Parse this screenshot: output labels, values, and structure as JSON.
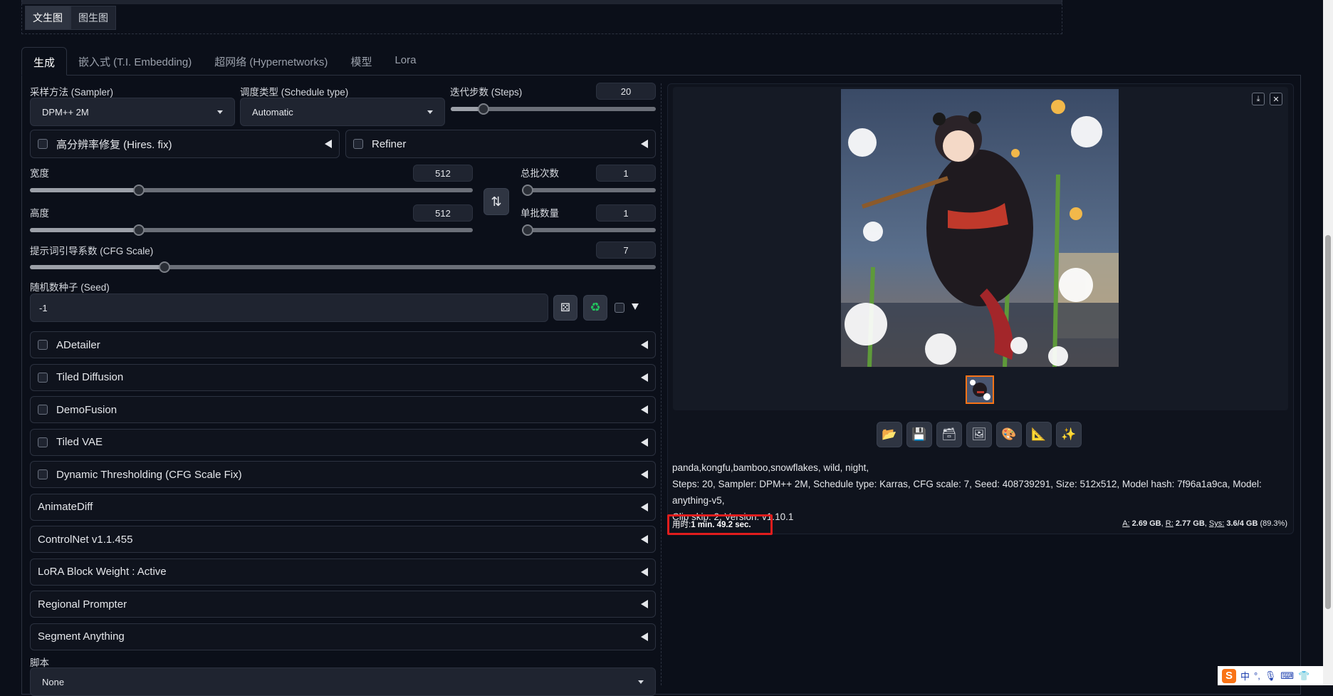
{
  "mode_tabs": [
    {
      "label": "文生图",
      "active": true
    },
    {
      "label": "图生图",
      "active": false
    }
  ],
  "main_tabs": [
    {
      "label": "生成",
      "active": true
    },
    {
      "label": "嵌入式 (T.I. Embedding)",
      "active": false
    },
    {
      "label": "超网络 (Hypernetworks)",
      "active": false
    },
    {
      "label": "模型",
      "active": false
    },
    {
      "label": "Lora",
      "active": false
    }
  ],
  "sampler": {
    "label": "采样方法 (Sampler)",
    "value": "DPM++ 2M"
  },
  "schedule": {
    "label": "调度类型 (Schedule type)",
    "value": "Automatic"
  },
  "steps": {
    "label": "迭代步数 (Steps)",
    "value": "20",
    "fraction": 0.14
  },
  "hires": {
    "label": "高分辨率修复 (Hires. fix)"
  },
  "refiner": {
    "label": "Refiner"
  },
  "width": {
    "label": "宽度",
    "value": "512",
    "fraction": 0.24
  },
  "height": {
    "label": "高度",
    "value": "512",
    "fraction": 0.24
  },
  "batch_count": {
    "label": "总批次数",
    "value": "1",
    "fraction": 0.0
  },
  "batch_size": {
    "label": "单批数量",
    "value": "1",
    "fraction": 0.0
  },
  "cfg": {
    "label": "提示词引导系数 (CFG Scale)",
    "value": "7",
    "fraction": 0.21
  },
  "seed": {
    "label": "随机数种子 (Seed)",
    "value": "-1"
  },
  "accordions": [
    {
      "label": "ADetailer",
      "checkbox": true
    },
    {
      "label": "Tiled Diffusion",
      "checkbox": true
    },
    {
      "label": "DemoFusion",
      "checkbox": true
    },
    {
      "label": "Tiled VAE",
      "checkbox": true
    },
    {
      "label": "Dynamic Thresholding (CFG Scale Fix)",
      "checkbox": true
    },
    {
      "label": "AnimateDiff",
      "checkbox": false
    },
    {
      "label": "ControlNet v1.1.455",
      "checkbox": false
    },
    {
      "label": "LoRA Block Weight : Active",
      "checkbox": false
    },
    {
      "label": "Regional Prompter",
      "checkbox": false
    },
    {
      "label": "Segment Anything",
      "checkbox": false
    }
  ],
  "script": {
    "label": "脚本",
    "value": "None"
  },
  "output": {
    "prompt": "panda,kongfu,bamboo,snowflakes, wild, night,",
    "params_line1": "Steps: 20, Sampler: DPM++ 2M, Schedule type: Karras, CFG scale: 7, Seed: 408739291, Size: 512x512, Model hash: 7f96a1a9ca, Model: anything-v5,",
    "params_line2": "Clip skip: 2, Version: v1.10.1",
    "time_label": "用时:",
    "time_value": "1 min. 49.2 sec.",
    "vram_a_label": "A:",
    "vram_a": "2.69 GB",
    "vram_r_label": "R:",
    "vram_r": "2.77 GB",
    "vram_sys_label": "Sys:",
    "vram_sys": "3.6/4 GB",
    "vram_pct": "(89.3%)"
  },
  "ime": {
    "logo": "S",
    "lang": "中",
    "punct": "°,"
  },
  "colors": {
    "accent_red": "#e11d1d",
    "thumb_border": "#f97316",
    "bg": "#0b0f19"
  }
}
